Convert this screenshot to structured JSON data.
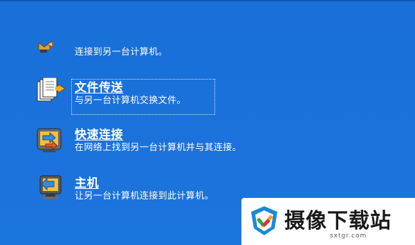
{
  "items": [
    {
      "title": "",
      "description": "连接到另一台计算机。",
      "icon": "computer-connect-icon"
    },
    {
      "title": "文件传送",
      "description": "与另一台计算机交换文件。",
      "icon": "file-transfer-icon"
    },
    {
      "title": "快速连接",
      "description": "在网络上找到另一台计算机并与其连接。",
      "icon": "quick-connect-icon"
    },
    {
      "title": "主机",
      "description": "让另一台计算机连接到此计算机。",
      "icon": "host-icon"
    }
  ],
  "watermark": {
    "name": "摄像下载站",
    "url": "sxtgr.com"
  },
  "colors": {
    "background": "#1b72dc",
    "text": "#ffffff",
    "watermark_bg": "#ffffff"
  }
}
